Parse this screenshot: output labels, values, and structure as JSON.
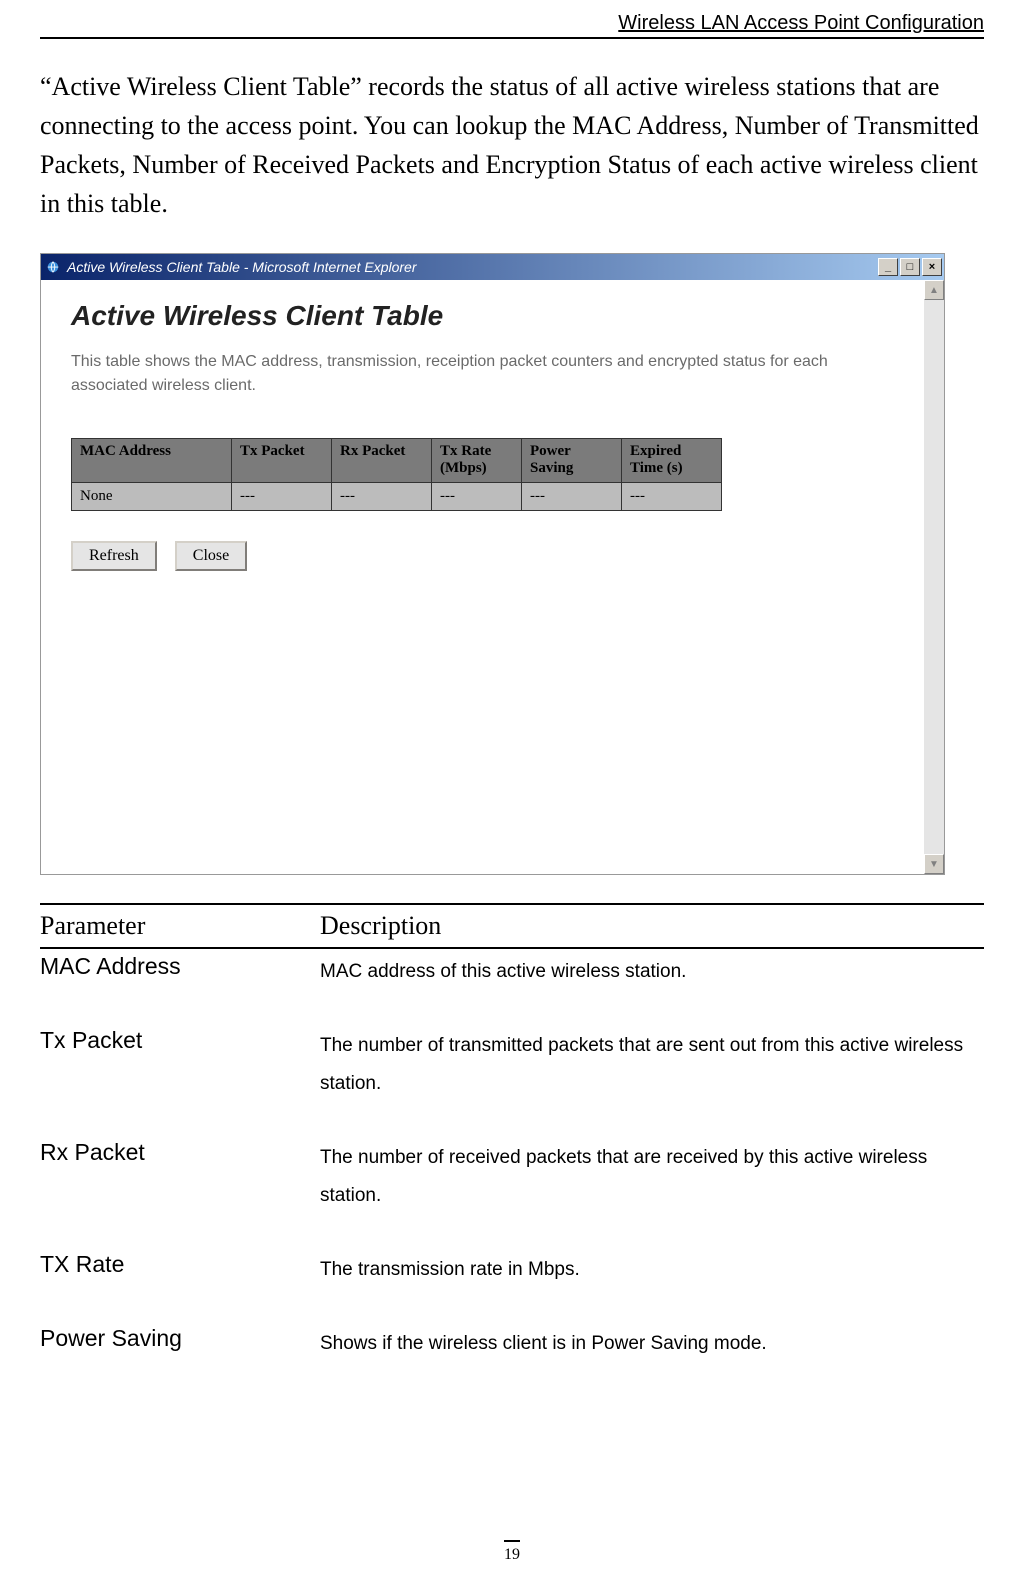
{
  "header": {
    "breadcrumb": "Wireless LAN Access Point Configuration"
  },
  "intro": "“Active Wireless Client Table” records the status of all active wireless stations that are connecting to the access point. You can lookup the MAC Address, Number of Transmitted Packets, Number of Received Packets and Encryption Status of each active wireless client in this table.",
  "screenshot": {
    "title": "Active Wireless Client Table - Microsoft Internet Explorer",
    "heading": "Active Wireless Client Table",
    "description": "This table shows the MAC address, transmission, receiption packet counters and encrypted status for each associated wireless client.",
    "table": {
      "headers": [
        "MAC Address",
        "Tx Packet",
        "Rx Packet",
        "Tx Rate (Mbps)",
        "Power Saving",
        "Expired Time (s)"
      ],
      "row": [
        "None",
        "---",
        "---",
        "---",
        "---",
        "---"
      ]
    },
    "buttons": {
      "refresh": "Refresh",
      "close": "Close"
    },
    "winbuttons": {
      "min": "_",
      "max": "□",
      "close": "×"
    },
    "scroll": {
      "up": "▲",
      "down": "▼"
    }
  },
  "param_table": {
    "header": {
      "c1": "Parameter",
      "c2": "Description"
    },
    "rows": [
      {
        "param": "MAC Address",
        "desc": "MAC address of this active wireless station."
      },
      {
        "param": "Tx Packet",
        "desc": "The number of transmitted packets that are sent out from this active wireless station."
      },
      {
        "param": "Rx Packet",
        "desc": "The number of received packets that are received by this active wireless station."
      },
      {
        "param": "TX Rate",
        "desc": "The transmission rate in Mbps."
      },
      {
        "param": "Power Saving",
        "desc": "Shows if the wireless client is in Power Saving mode."
      }
    ]
  },
  "page_number": "19"
}
